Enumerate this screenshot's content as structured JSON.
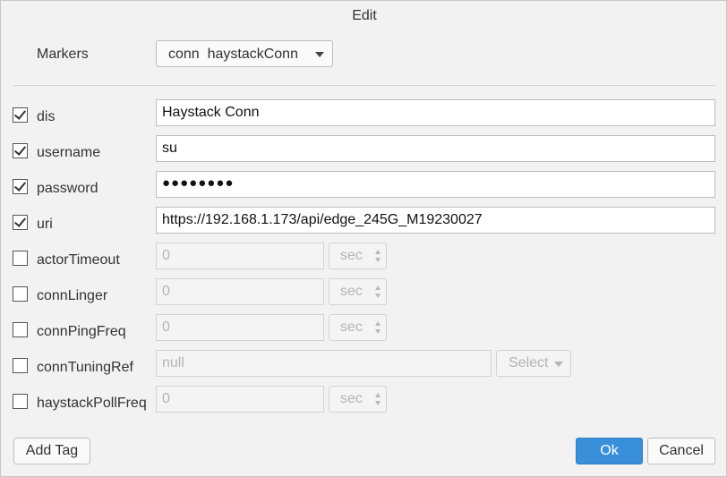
{
  "dialog": {
    "title": "Edit"
  },
  "markers": {
    "label": "Markers",
    "value": "conn  haystackConn"
  },
  "tags": [
    {
      "name": "dis",
      "checked": true,
      "value": "Haystack Conn"
    },
    {
      "name": "username",
      "checked": true,
      "value": "su"
    },
    {
      "name": "password",
      "checked": true,
      "value": "●●●●●●●●"
    },
    {
      "name": "uri",
      "checked": true,
      "value": "https://192.168.1.173/api/edge_245G_M19230027"
    },
    {
      "name": "actorTimeout",
      "checked": false,
      "value": "0",
      "unit": "sec"
    },
    {
      "name": "connLinger",
      "checked": false,
      "value": "0",
      "unit": "sec"
    },
    {
      "name": "connPingFreq",
      "checked": false,
      "value": "0",
      "unit": "sec"
    },
    {
      "name": "connTuningRef",
      "checked": false,
      "value": "null",
      "select": "Select"
    },
    {
      "name": "haystackPollFreq",
      "checked": false,
      "value": "0",
      "unit": "sec"
    }
  ],
  "footer": {
    "add_tag": "Add Tag",
    "ok": "Ok",
    "cancel": "Cancel"
  },
  "colors": {
    "primary_button": "#3a8fd9",
    "background": "#f2f2f2"
  }
}
